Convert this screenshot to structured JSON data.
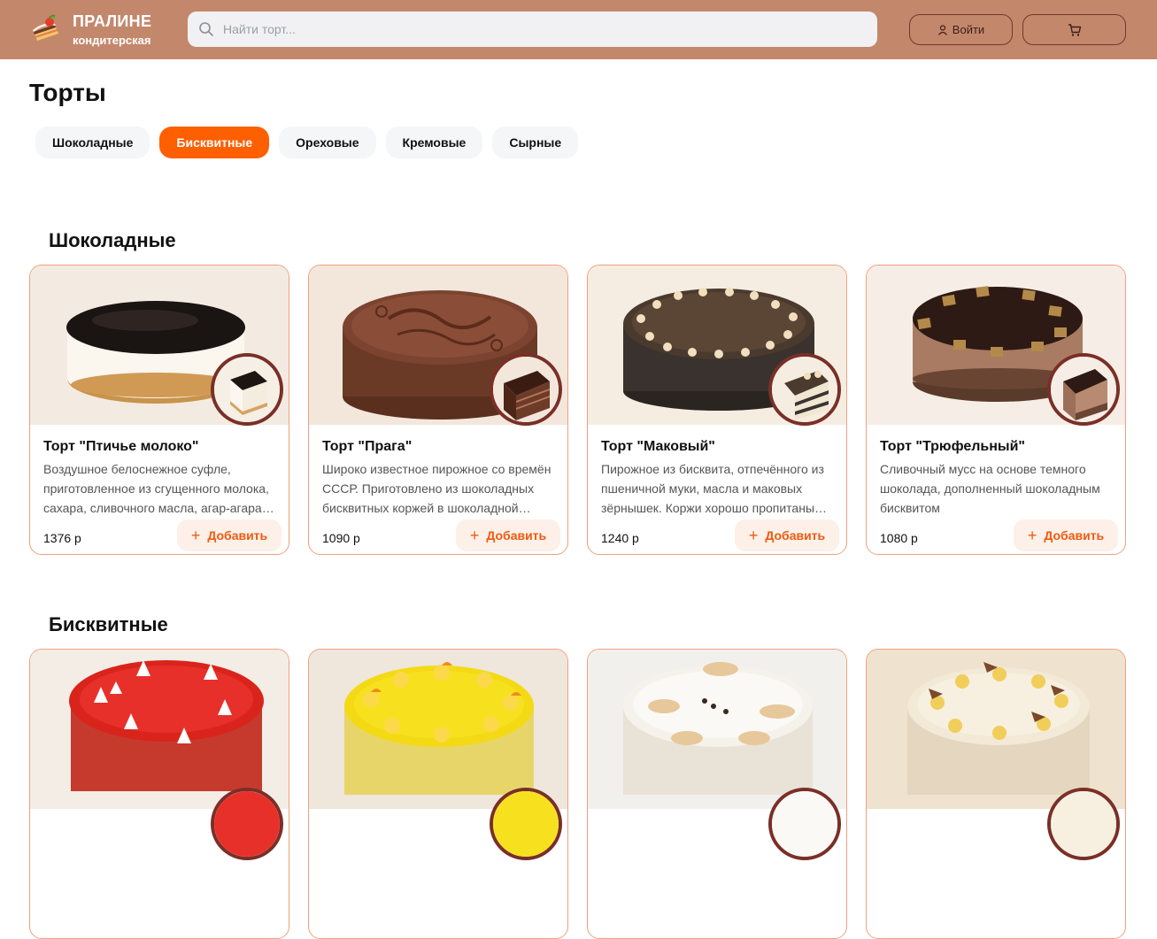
{
  "header": {
    "logo_name": "ПРАЛИНЕ",
    "logo_sub": "кондитерская",
    "search_placeholder": "Найти торт...",
    "login_label": "Войти"
  },
  "page_title": "Торты",
  "tabs": [
    {
      "label": "Шоколадные",
      "active": false
    },
    {
      "label": "Бисквитные",
      "active": true
    },
    {
      "label": "Ореховые",
      "active": false
    },
    {
      "label": "Кремовые",
      "active": false
    },
    {
      "label": "Сырные",
      "active": false
    }
  ],
  "sections": [
    {
      "title": "Шоколадные",
      "cards": [
        {
          "title": "Торт \"Птичье молоко\"",
          "desc": "Воздушное белоснежное суфле, приготовленное из сгущенного молока, сахара, сливочного масла, агар-агара и яичных белков.",
          "price": "1376 р",
          "add": "Добавить"
        },
        {
          "title": "Торт \"Прага\"",
          "desc": "Широко известное пирожное со времён СССР. Приготовлено из шоколадных бисквитных коржей в шоколадной глазури.",
          "price": "1090 р",
          "add": "Добавить"
        },
        {
          "title": "Торт \"Маковый\"",
          "desc": "Пирожное из бисквита, отпечённого из пшеничной муки, масла и маковых зёрнышек. Коржи хорошо пропитаны кремом.",
          "price": "1240 р",
          "add": "Добавить"
        },
        {
          "title": "Торт \"Трюфельный\"",
          "desc": "Сливочный мусс на основе темного шоколада, дополненный шоколадным бисквитом",
          "price": "1080 р",
          "add": "Добавить"
        }
      ]
    },
    {
      "title": "Бисквитные",
      "cards": []
    }
  ],
  "colors": {
    "header_bg": "#c3876c",
    "accent": "#fe5f00",
    "card_border": "#f0a07e",
    "add_text": "#ef5a10"
  }
}
